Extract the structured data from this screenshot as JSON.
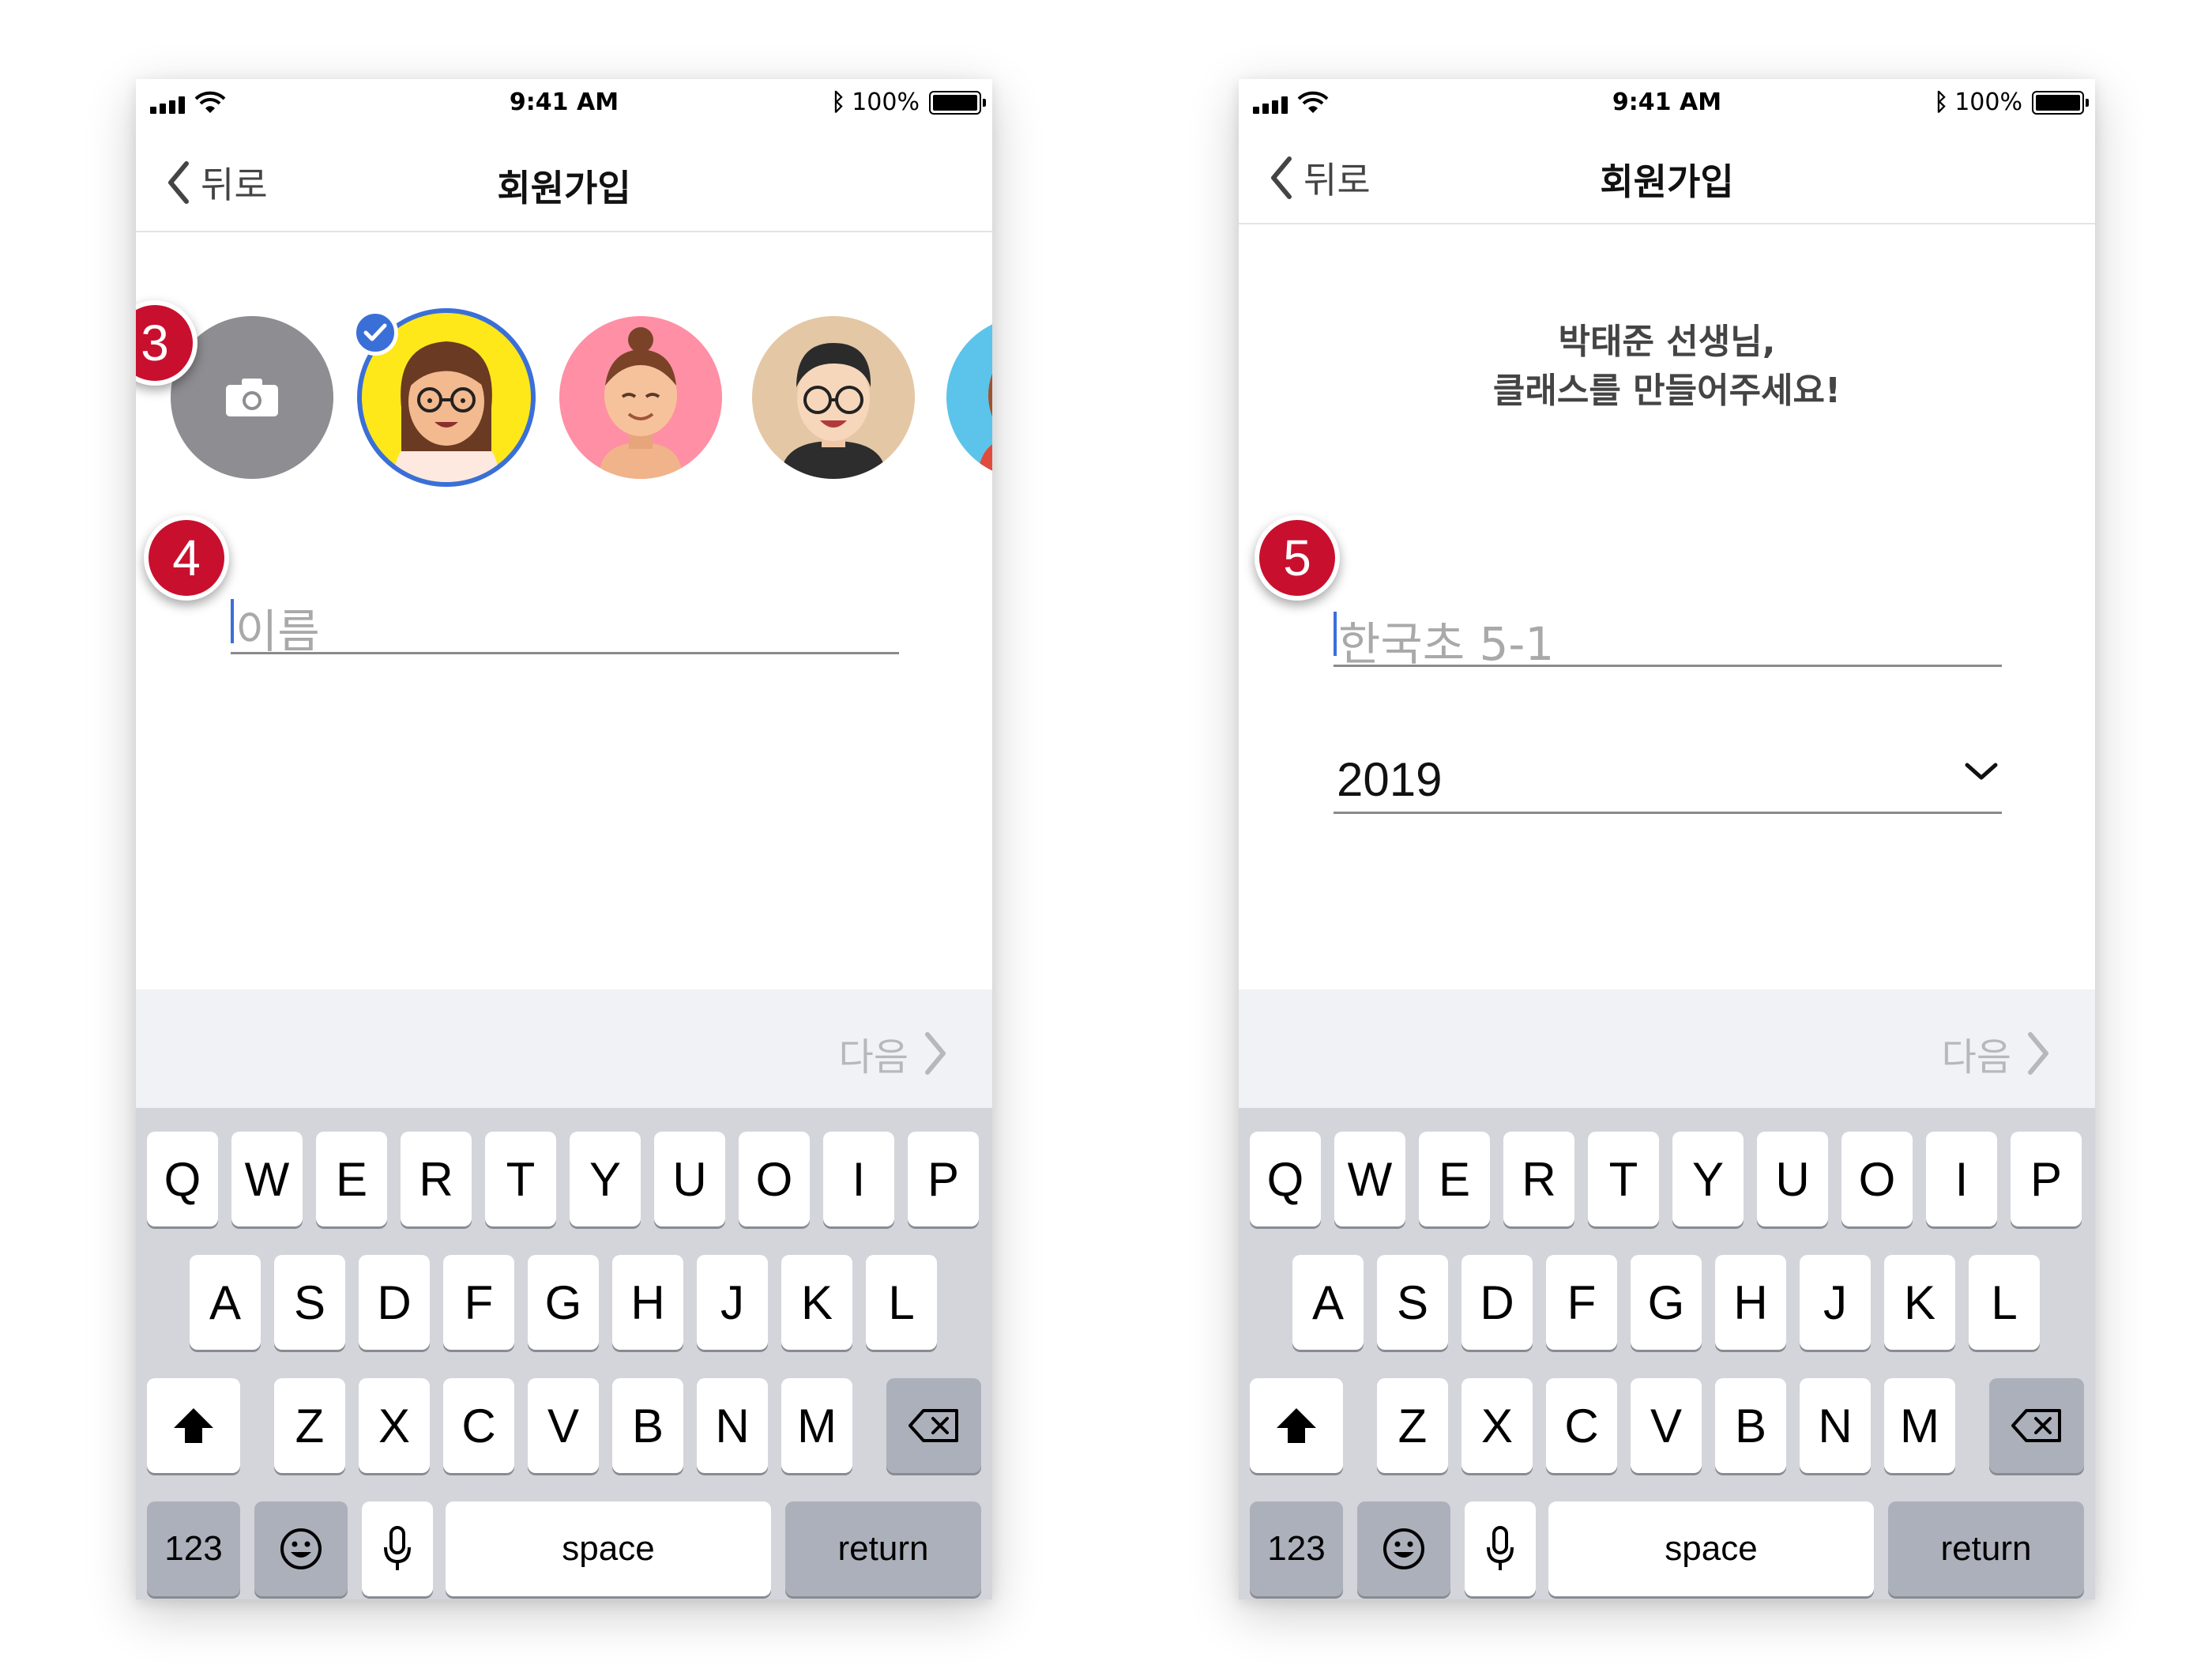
{
  "status_bar": {
    "time": "9:41 AM",
    "battery": "100%"
  },
  "nav": {
    "back_label": "뒤로",
    "title": "회원가입"
  },
  "left_screen": {
    "badge_avatar": "3",
    "badge_name": "4",
    "avatars": [
      "camera-icon",
      "avatar-girl-glasses",
      "avatar-boy-bun",
      "avatar-man-glasses",
      "avatar-partial"
    ],
    "selected_avatar": 1,
    "name_placeholder": "이름"
  },
  "right_screen": {
    "greeting_line1": "박태준 선생님,",
    "greeting_line2": "클래스를 만들어주세요!",
    "badge_class": "5",
    "class_placeholder": "한국초 5-1",
    "year_value": "2019"
  },
  "next_label": "다음",
  "keyboard": {
    "row1": [
      "Q",
      "W",
      "E",
      "R",
      "T",
      "Y",
      "U",
      "O",
      "I",
      "P"
    ],
    "row2": [
      "A",
      "S",
      "D",
      "F",
      "G",
      "H",
      "J",
      "K",
      "L"
    ],
    "row3": [
      "Z",
      "X",
      "C",
      "V",
      "B",
      "N",
      "M"
    ],
    "num_label": "123",
    "space_label": "space",
    "return_label": "return"
  },
  "colors": {
    "badge": "#c8102e",
    "accent": "#3b6fd8",
    "selected_ring": "#ffe81a"
  }
}
